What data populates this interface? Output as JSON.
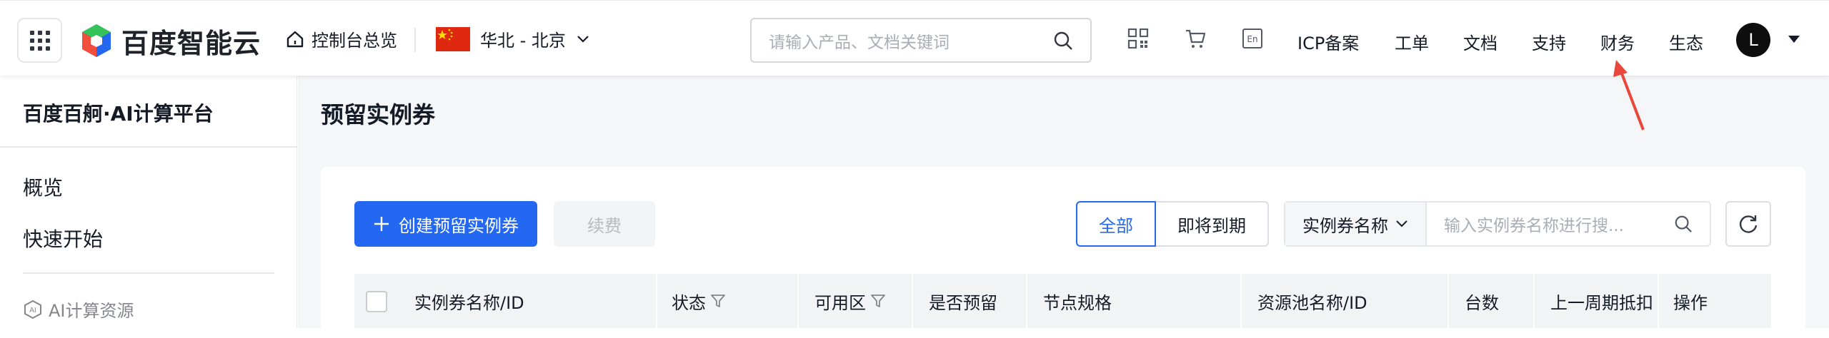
{
  "topbar": {
    "brand": "百度智能云",
    "console_link": "控制台总览",
    "region": "华北 - 北京",
    "search_placeholder": "请输入产品、文档关键词",
    "lang_icon_text": "En",
    "nav": [
      "ICP备案",
      "工单",
      "文档",
      "支持",
      "财务",
      "生态"
    ],
    "avatar_letter": "L"
  },
  "sidebar": {
    "title": "百度百舸·AI计算平台",
    "items": [
      "概览",
      "快速开始"
    ],
    "group_label": "AI计算资源",
    "group_icon_text": "AI"
  },
  "main": {
    "page_title": "预留实例券",
    "create_button": "创建预留实例券",
    "renew_button": "续费",
    "segments": [
      "全部",
      "即将到期"
    ],
    "filter_select": "实例券名称",
    "filter_placeholder": "输入实例券名称进行搜...",
    "columns": [
      "实例券名称/ID",
      "状态",
      "可用区",
      "是否预留",
      "节点规格",
      "资源池名称/ID",
      "台数",
      "上一周期抵扣",
      "操作"
    ]
  },
  "colors": {
    "primary": "#2468f2",
    "annotation_arrow": "#e8473b"
  }
}
